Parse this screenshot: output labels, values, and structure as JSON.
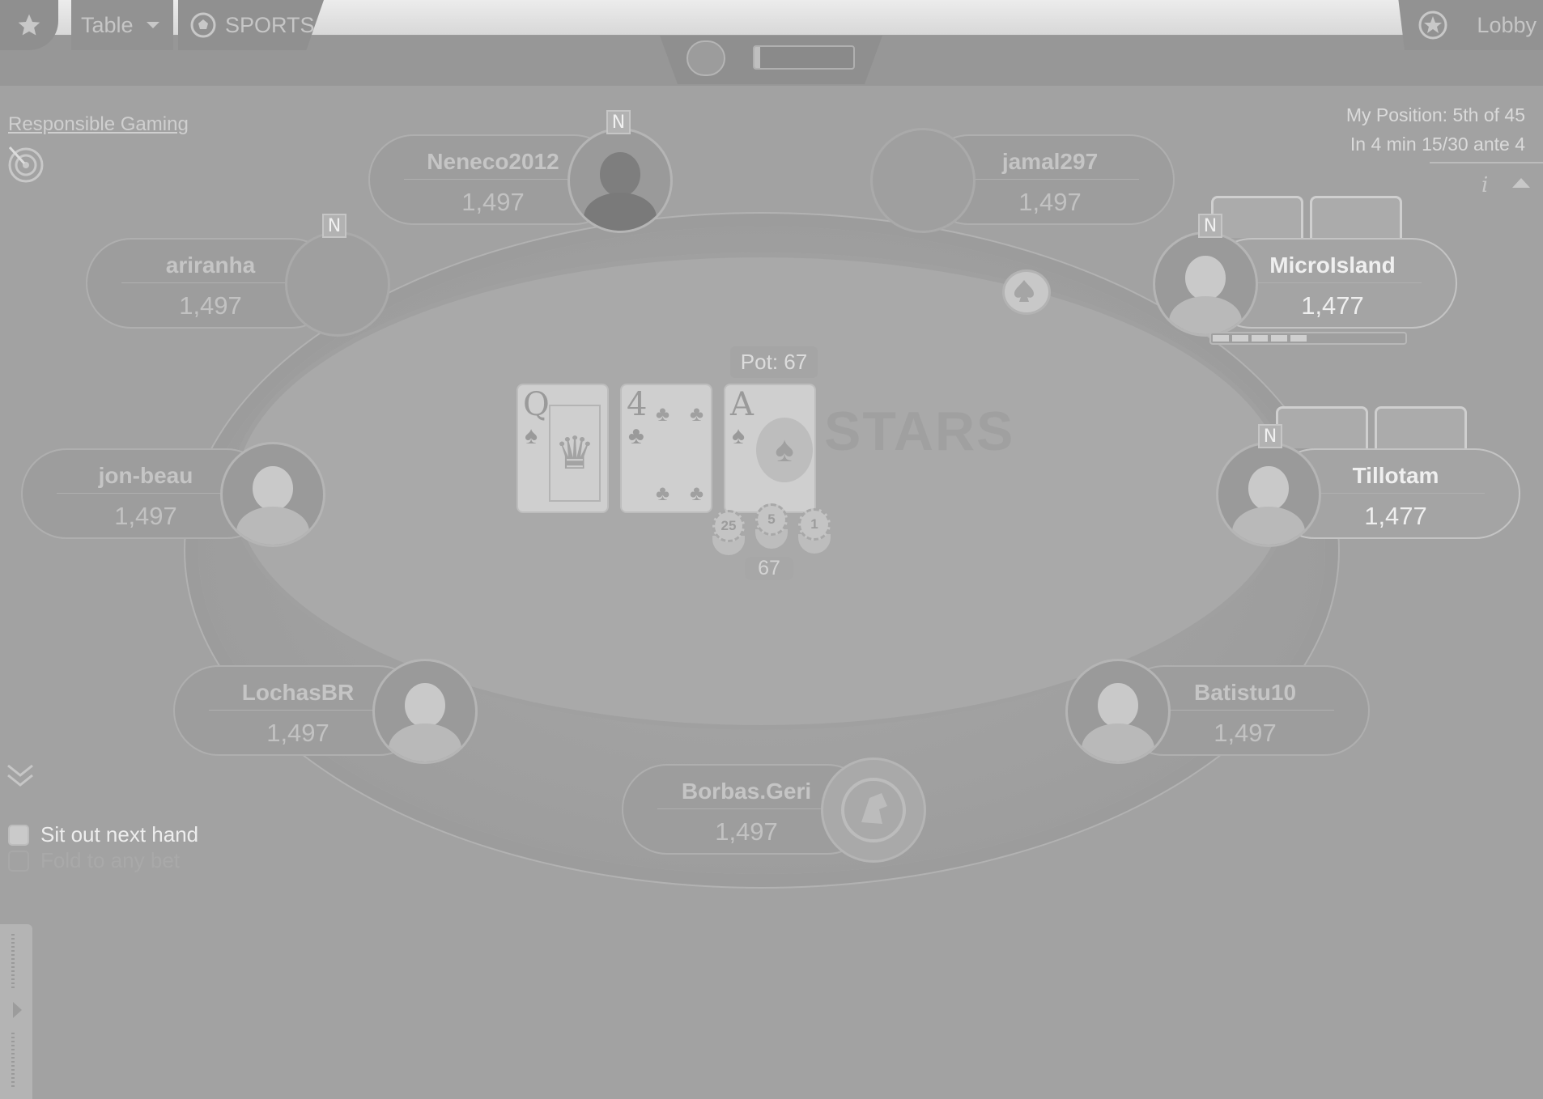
{
  "toolbar": {
    "table_label": "Table",
    "sports_label": "SPORTS",
    "lobby_label": "Lobby",
    "timebank_fraction": 0.06
  },
  "sidebar": {
    "responsible_gaming": "Responsible Gaming",
    "position_line1": "My Position: 5th of 45",
    "position_line2": "In 4 min 15/30 ante 4",
    "info_icon": "i"
  },
  "table": {
    "felt_logo": "STARS",
    "pot_label": "Pot: 67",
    "pot_amount": "67",
    "board": [
      {
        "rank": "Q",
        "suit": "♠"
      },
      {
        "rank": "4",
        "suit": "♣"
      },
      {
        "rank": "A",
        "suit": "♠"
      }
    ],
    "chips": [
      "25",
      "5",
      "1"
    ]
  },
  "seats": [
    {
      "name": "Neneco2012",
      "stack": "1,497",
      "note": "N"
    },
    {
      "name": "jamal297",
      "stack": "1,497"
    },
    {
      "name": "ariranha",
      "stack": "1,497",
      "note": "N"
    },
    {
      "name": "MicroIsland",
      "stack": "1,477",
      "note": "N"
    },
    {
      "name": "jon-beau",
      "stack": "1,497"
    },
    {
      "name": "Tillotam",
      "stack": "1,477",
      "note": "N"
    },
    {
      "name": "LochasBR",
      "stack": "1,497"
    },
    {
      "name": "Batistu10",
      "stack": "1,497"
    },
    {
      "name": "Borbas.Geri",
      "stack": "1,497"
    }
  ],
  "controls": {
    "sit_out": "Sit out next hand",
    "fold_any": "Fold to any bet"
  },
  "icons": {
    "star": "star-icon",
    "dropdown": "chevron-down-icon",
    "sports": "soccer-ball-icon",
    "lobby": "pokerstars-logo-icon",
    "dealer": "dealer-button-icon"
  }
}
